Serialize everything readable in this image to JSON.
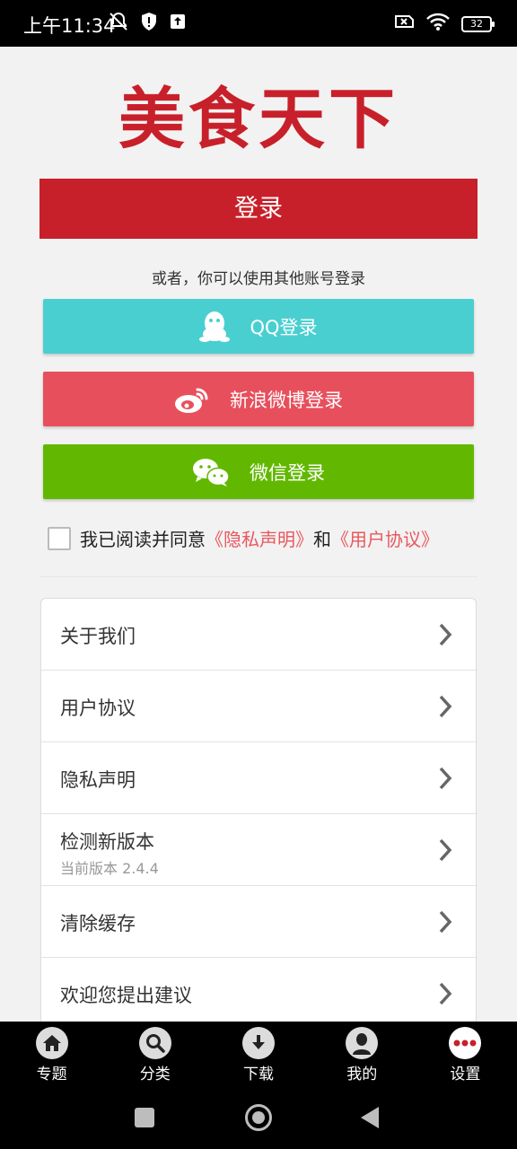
{
  "status_bar": {
    "time": "上午11:34",
    "battery": "32",
    "icons": [
      "notifications-off-icon",
      "shield-alert-icon",
      "upload-icon",
      "sim-x-icon",
      "wifi-icon",
      "battery-icon"
    ]
  },
  "app": {
    "title": "美食天下",
    "brand_color": "#c8202a"
  },
  "login": {
    "button_label": "登录",
    "alt_text": "或者，你可以使用其他账号登录",
    "qq_label": "QQ登录",
    "weibo_label": "新浪微博登录",
    "wechat_label": "微信登录",
    "colors": {
      "qq": "#4acfd1",
      "weibo": "#e84f5c",
      "wechat": "#62b800"
    }
  },
  "agreement": {
    "prefix": "我已阅读并同意",
    "privacy_link": "《隐私声明》",
    "and": "和",
    "terms_link": "《用户协议》",
    "checked": false
  },
  "menu": {
    "items": [
      {
        "label": "关于我们"
      },
      {
        "label": "用户协议"
      },
      {
        "label": "隐私声明"
      },
      {
        "label": "检测新版本",
        "sub": "当前版本 2.4.4"
      },
      {
        "label": "清除缓存"
      },
      {
        "label": "欢迎您提出建议"
      }
    ]
  },
  "bottom_nav": {
    "items": [
      {
        "label": "专题",
        "icon": "home-icon"
      },
      {
        "label": "分类",
        "icon": "search-icon"
      },
      {
        "label": "下载",
        "icon": "download-icon"
      },
      {
        "label": "我的",
        "icon": "user-icon"
      },
      {
        "label": "设置",
        "icon": "more-icon",
        "active": true
      }
    ]
  }
}
